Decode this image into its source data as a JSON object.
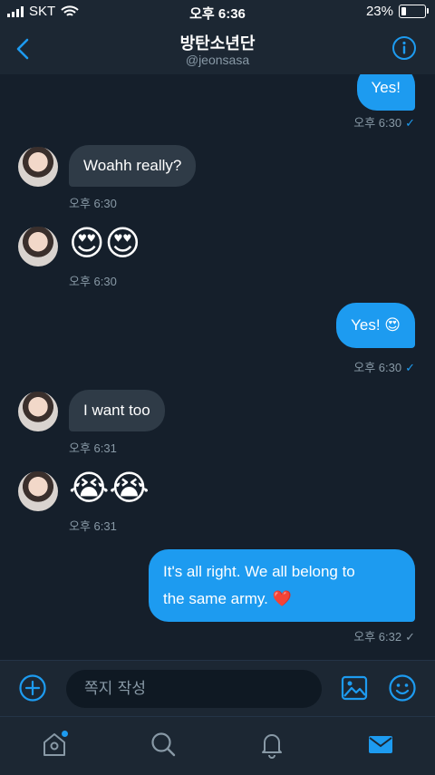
{
  "status": {
    "carrier": "SKT",
    "time": "오후 6:36",
    "battery": "23%",
    "battery_level": 0.23
  },
  "header": {
    "title": "방탄소년단",
    "handle": "@jeonsasa"
  },
  "messages": [
    {
      "side": "out",
      "text": "Yes!",
      "time": "오후 6:30",
      "read": true
    },
    {
      "side": "in",
      "text": "Woahh really?",
      "time": "오후 6:30"
    },
    {
      "side": "in",
      "emoji": "😍😍",
      "time": "오후 6:30"
    },
    {
      "side": "out",
      "text": "Yes! 😍",
      "time": "오후 6:30",
      "read": true
    },
    {
      "side": "in",
      "text": "I want too",
      "time": "오후 6:31"
    },
    {
      "side": "in",
      "emoji": "😭😭",
      "time": "오후 6:31"
    },
    {
      "side": "out",
      "text_line1": "It's all right. We all belong to",
      "text_line2": "the same army.",
      "heart": "❤️",
      "time": "오후 6:32",
      "read": false
    }
  ],
  "composer": {
    "placeholder": "쪽지 작성"
  },
  "tabs": [
    "home",
    "search",
    "notifications",
    "messages"
  ],
  "colors": {
    "accent": "#1d9bf0",
    "background": "#151f2b",
    "bubble_in": "#2f3b47"
  }
}
